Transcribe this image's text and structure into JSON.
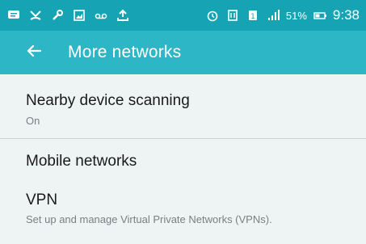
{
  "status_bar": {
    "battery_percent": "51%",
    "time": "9:38",
    "icons": [
      "message-icon",
      "missed-call-icon",
      "wrench-icon",
      "photo-icon",
      "voicemail-icon",
      "upload-icon",
      "alarm-icon",
      "nfc-icon",
      "sim-icon",
      "signal-icon",
      "battery-icon"
    ]
  },
  "app_bar": {
    "title": "More networks",
    "back_icon": "arrow-left-icon"
  },
  "settings": [
    {
      "title": "Nearby device scanning",
      "subtitle": "On"
    },
    {
      "title": "Mobile networks"
    },
    {
      "title": "VPN",
      "subtitle": "Set up and manage Virtual Private Networks (VPNs)."
    }
  ],
  "colors": {
    "status_bar": "#16a4b4",
    "app_bar": "#2db6c5",
    "background": "#eef3f4"
  }
}
